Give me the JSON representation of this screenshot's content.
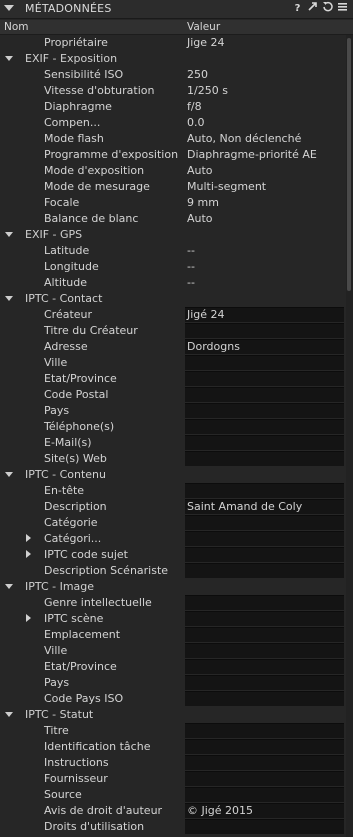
{
  "panel": {
    "title": "MÉTADONNÉES",
    "icons": [
      "help-icon",
      "expand-icon",
      "reset-icon",
      "menu-icon"
    ]
  },
  "columns": {
    "name": "Nom",
    "value": "Valeur"
  },
  "rows": [
    {
      "kind": "item",
      "name": "Propriétaire",
      "value": "Jige 24"
    },
    {
      "kind": "section",
      "name": "EXIF - Exposition"
    },
    {
      "kind": "item",
      "name": "Sensibilité ISO",
      "value": "250"
    },
    {
      "kind": "item",
      "name": "Vitesse d'obturation",
      "value": "1/250 s"
    },
    {
      "kind": "item",
      "name": "Diaphragme",
      "value": "f/8"
    },
    {
      "kind": "item",
      "name": "Compen...",
      "value": "0.0"
    },
    {
      "kind": "item",
      "name": "Mode flash",
      "value": "Auto, Non déclenché"
    },
    {
      "kind": "item",
      "name": "Programme d'exposition",
      "value": "Diaphragme-priorité AE"
    },
    {
      "kind": "item",
      "name": "Mode d'exposition",
      "value": "Auto"
    },
    {
      "kind": "item",
      "name": "Mode de mesurage",
      "value": "Multi-segment"
    },
    {
      "kind": "item",
      "name": "Focale",
      "value": "9 mm"
    },
    {
      "kind": "item",
      "name": "Balance de blanc",
      "value": "Auto"
    },
    {
      "kind": "section",
      "name": "EXIF - GPS"
    },
    {
      "kind": "item",
      "name": "Latitude",
      "value": "--"
    },
    {
      "kind": "item",
      "name": "Longitude",
      "value": "--"
    },
    {
      "kind": "item",
      "name": "Altitude",
      "value": "--"
    },
    {
      "kind": "section",
      "name": "IPTC - Contact"
    },
    {
      "kind": "field",
      "name": "Créateur",
      "value": "Jigé 24"
    },
    {
      "kind": "field",
      "name": "Titre du Créateur",
      "value": ""
    },
    {
      "kind": "field",
      "name": "Adresse",
      "value": "Dordogns"
    },
    {
      "kind": "field",
      "name": "Ville",
      "value": ""
    },
    {
      "kind": "field",
      "name": "Etat/Province",
      "value": ""
    },
    {
      "kind": "field",
      "name": "Code Postal",
      "value": ""
    },
    {
      "kind": "field",
      "name": "Pays",
      "value": ""
    },
    {
      "kind": "field",
      "name": "Téléphone(s)",
      "value": ""
    },
    {
      "kind": "field",
      "name": "E-Mail(s)",
      "value": ""
    },
    {
      "kind": "field",
      "name": "Site(s) Web",
      "value": ""
    },
    {
      "kind": "section",
      "name": "IPTC - Contenu"
    },
    {
      "kind": "field",
      "name": "En-tête",
      "value": ""
    },
    {
      "kind": "field",
      "name": "Description",
      "value": "Saint Amand de Coly"
    },
    {
      "kind": "field",
      "name": "Catégorie",
      "value": ""
    },
    {
      "kind": "field",
      "name": "Catégori...",
      "value": "",
      "expander": true
    },
    {
      "kind": "field",
      "name": "IPTC code sujet",
      "value": "",
      "expander": true
    },
    {
      "kind": "field",
      "name": "Description Scénariste",
      "value": ""
    },
    {
      "kind": "section",
      "name": "IPTC - Image"
    },
    {
      "kind": "field",
      "name": "Genre intellectuelle",
      "value": ""
    },
    {
      "kind": "field",
      "name": "IPTC scène",
      "value": "",
      "expander": true
    },
    {
      "kind": "field",
      "name": "Emplacement",
      "value": ""
    },
    {
      "kind": "field",
      "name": "Ville",
      "value": ""
    },
    {
      "kind": "field",
      "name": "Etat/Province",
      "value": ""
    },
    {
      "kind": "field",
      "name": "Pays",
      "value": ""
    },
    {
      "kind": "field",
      "name": "Code Pays ISO",
      "value": ""
    },
    {
      "kind": "section",
      "name": "IPTC - Statut"
    },
    {
      "kind": "field",
      "name": "Titre",
      "value": ""
    },
    {
      "kind": "field",
      "name": "Identification tâche",
      "value": ""
    },
    {
      "kind": "field",
      "name": "Instructions",
      "value": ""
    },
    {
      "kind": "field",
      "name": "Fournisseur",
      "value": ""
    },
    {
      "kind": "field",
      "name": "Source",
      "value": ""
    },
    {
      "kind": "field",
      "name": "Avis de droit d'auteur",
      "value": "© Jigé 2015"
    },
    {
      "kind": "field",
      "name": "Droits d'utilisation",
      "value": ""
    }
  ]
}
